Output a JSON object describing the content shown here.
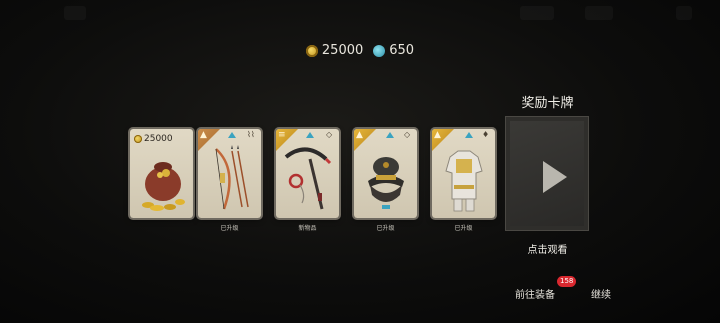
{
  "currency": {
    "coins": "25000",
    "gems": "650"
  },
  "cards": [
    {
      "kind": "coins",
      "amount": "25000",
      "caption": ""
    },
    {
      "kind": "bow",
      "caption": "已升级"
    },
    {
      "kind": "kusarigama",
      "caption": "新物品"
    },
    {
      "kind": "helmet",
      "caption": "已升级"
    },
    {
      "kind": "armor",
      "caption": "已升级"
    }
  ],
  "reward": {
    "title": "奖励卡牌",
    "watch_label": "点击观看"
  },
  "footer": {
    "equip_label": "前往装备",
    "equip_count": "158",
    "continue_label": "继续"
  },
  "colors": {
    "accent_orange": "#c98c4a",
    "accent_gold": "#e6b53a",
    "gem_blue": "#3aa3c0",
    "badge_red": "#d9282f"
  }
}
